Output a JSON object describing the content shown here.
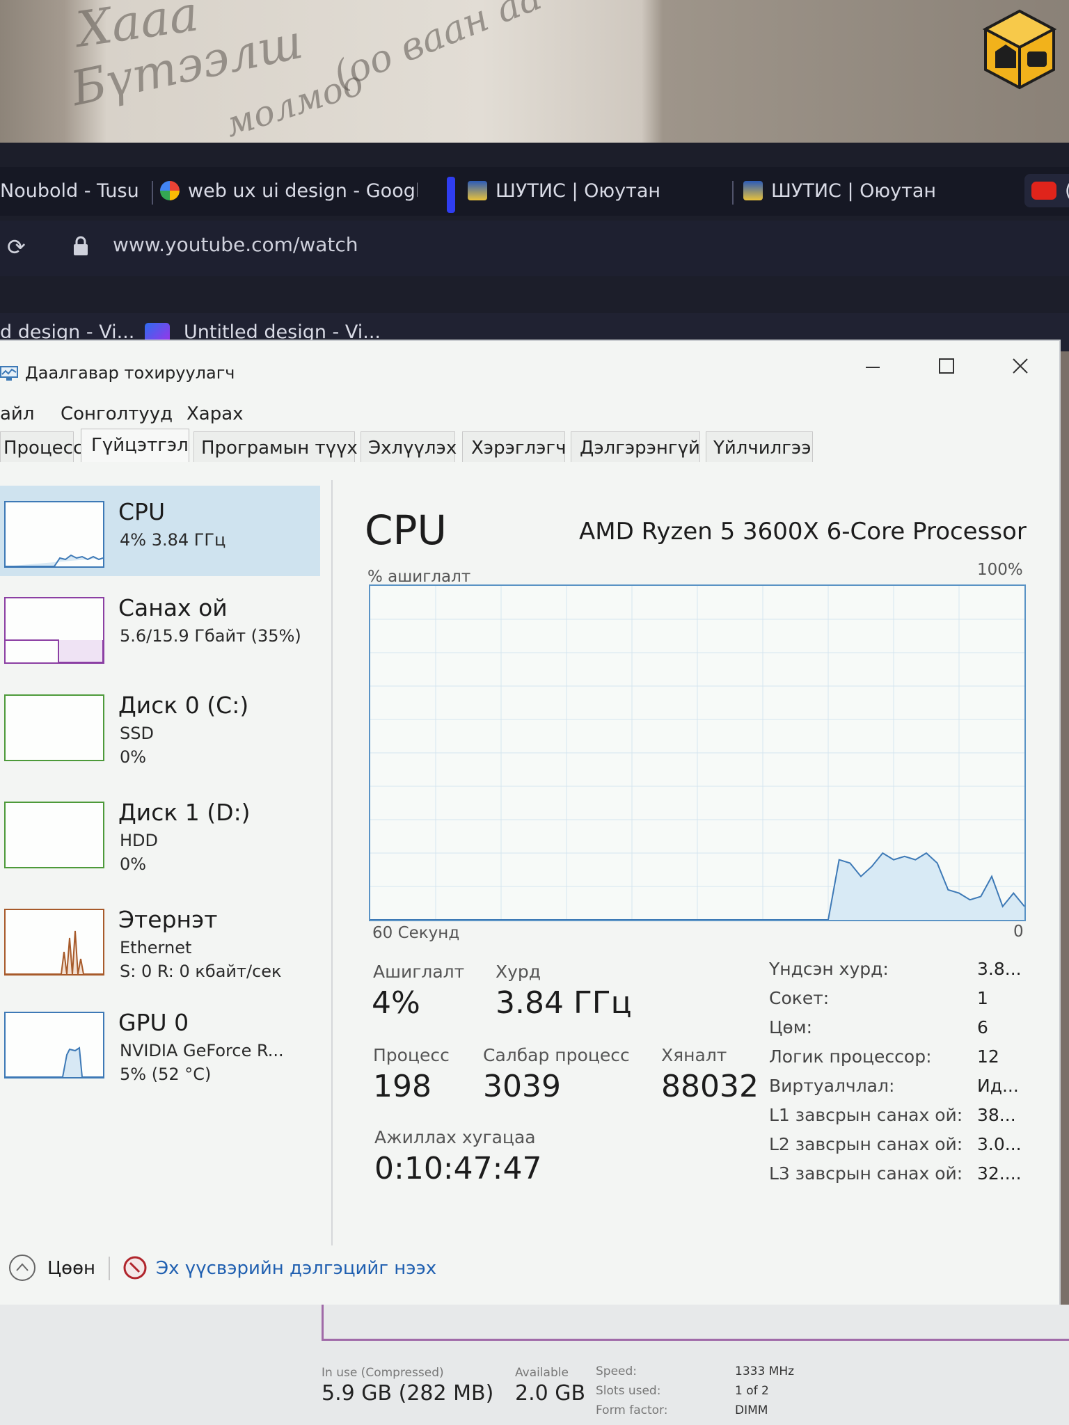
{
  "browser": {
    "tabs": [
      {
        "label": "Noubold - Tusu",
        "icon": "page-icon"
      },
      {
        "label": "web ux ui design - Google",
        "icon": "google-icon"
      },
      {
        "label": "ШУТИС | Оюутан",
        "icon": "university-crest-icon"
      },
      {
        "label": "ШУТИС | Оюутан",
        "icon": "university-crest-icon"
      },
      {
        "label": "(",
        "icon": "youtube-icon"
      }
    ],
    "url": "www.youtube.com/watch",
    "bookmarks": [
      {
        "label": "d design - Vi..."
      },
      {
        "label": "Untitled design - Vi...",
        "icon": "video-editor-icon"
      }
    ]
  },
  "task_manager": {
    "title": "Даалгавар тохируулагч",
    "menu": [
      "Файл",
      "Сонголтууд",
      "Харах"
    ],
    "menu_visible": [
      "айл",
      "Сонголтууд",
      "Харах"
    ],
    "tabs": [
      "Процесс",
      "Гүйцэтгэл",
      "Програмын түүх",
      "Эхлүүлэх",
      "Хэрэглэгч",
      "Дэлгэрэнгүй",
      "Үйлчилгээ"
    ],
    "active_tab": "Гүйцэтгэл",
    "sidebar": [
      {
        "name": "CPU",
        "line1": "4% 3.84 ГГц",
        "line2": "",
        "color": "#3d79b6",
        "selected": true
      },
      {
        "name": "Санах ой",
        "line1": "5.6/15.9 Гбайт (35%)",
        "line2": "",
        "color": "#8b3fa3"
      },
      {
        "name": "Диск 0 (C:)",
        "line1": "SSD",
        "line2": "0%",
        "color": "#4d9a3a"
      },
      {
        "name": "Диск 1 (D:)",
        "line1": "HDD",
        "line2": "0%",
        "color": "#4d9a3a"
      },
      {
        "name": "Этернэт",
        "line1": "Ethernet",
        "line2": "S: 0 R: 0 кбайт/сек",
        "color": "#a75a2a"
      },
      {
        "name": "GPU 0",
        "line1": "NVIDIA GeForce R...",
        "line2": "5% (52 °C)",
        "color": "#3d79b6"
      }
    ],
    "main": {
      "title": "CPU",
      "model": "AMD Ryzen 5 3600X 6-Core Processor",
      "y_label": "% ашиглалт",
      "y_max": "100%",
      "x_left": "60 Секунд",
      "x_right": "0",
      "stats": {
        "utilization_label": "Ашиглалт",
        "utilization": "4%",
        "speed_label": "Хурд",
        "speed": "3.84 ГГц",
        "processes_label": "Процесс",
        "processes": "198",
        "threads_label": "Салбар процесс",
        "threads": "3039",
        "handles_label": "Хяналт",
        "handles": "88032",
        "uptime_label": "Ажиллах хугацаа",
        "uptime": "0:10:47:47"
      },
      "details": [
        {
          "label": "Үндсэн хурд:",
          "value": "3.8..."
        },
        {
          "label": "Сокет:",
          "value": "1"
        },
        {
          "label": "Цөм:",
          "value": "6"
        },
        {
          "label": "Логик процессор:",
          "value": "12"
        },
        {
          "label": "Виртуалчлал:",
          "value": "Ид..."
        },
        {
          "label": "L1 завсрын санах ой:",
          "value": "38..."
        },
        {
          "label": "L2 завсрын санах ой:",
          "value": "3.0..."
        },
        {
          "label": "L3 завсрын санах ой:",
          "value": "32...."
        }
      ]
    },
    "footer": {
      "collapse": "Цөөн",
      "monitor_link": "Эх үүсвэрийн дэлгэцийг нээх"
    }
  },
  "chart_data": {
    "type": "line",
    "xlabel": "60 Секунд",
    "ylabel": "% ашиглалт",
    "ylim": [
      0,
      100
    ],
    "xlim": [
      60,
      0
    ],
    "series": [
      {
        "x": [
          60,
          18,
          17,
          16,
          15,
          14,
          13,
          12,
          11,
          10,
          9,
          8,
          7,
          6,
          5,
          4,
          3,
          2,
          1,
          0
        ],
        "values": [
          0,
          0,
          18,
          17,
          13,
          16,
          20,
          18,
          19,
          18,
          20,
          17,
          9,
          8,
          6,
          7,
          13,
          4,
          8,
          4
        ]
      }
    ]
  },
  "underlying_window": {
    "in_use_label": "In use (Compressed)",
    "in_use": "5.9 GB (282 MB)",
    "available_label": "Available",
    "available": "2.0 GB",
    "speed_label": "Speed:",
    "speed": "1333 MHz",
    "slots_label": "Slots used:",
    "slots": "1 of 2",
    "form_label": "Form factor:",
    "form": "DIMM"
  },
  "colors": {
    "accent": "#3d79b6",
    "link": "#1f5fb0",
    "selected_bg": "#cfe3ef"
  }
}
